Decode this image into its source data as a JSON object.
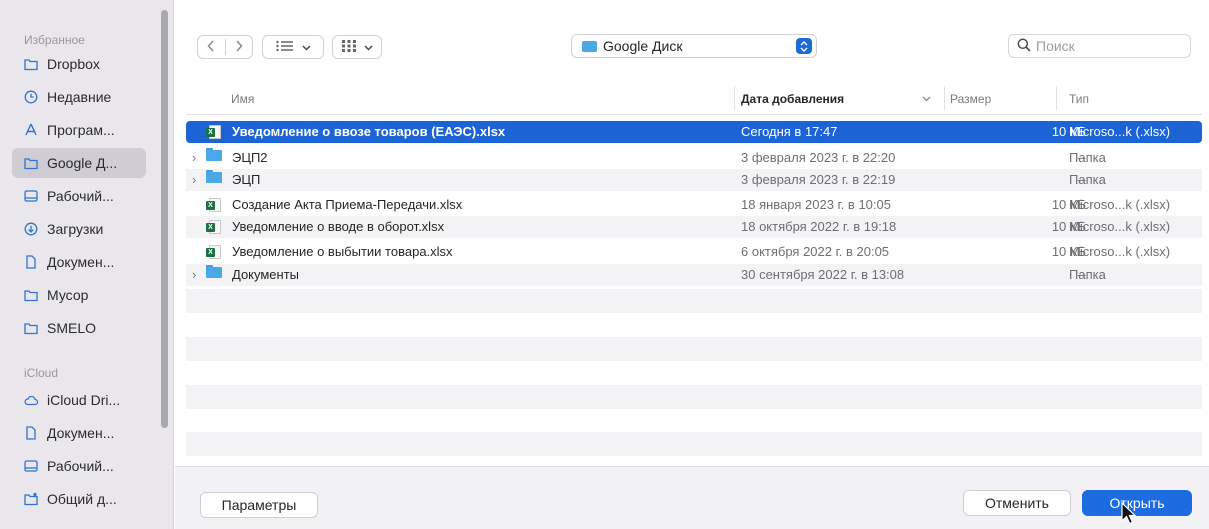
{
  "sidebar": {
    "favorites_header": "Избранное",
    "favorites": [
      {
        "label": "Dropbox",
        "icon": "folder-icon",
        "active": false
      },
      {
        "label": "Недавние",
        "icon": "clock-icon",
        "active": false
      },
      {
        "label": "Програм...",
        "icon": "apps-icon",
        "active": false
      },
      {
        "label": "Google Д...",
        "icon": "folder-icon",
        "active": true
      },
      {
        "label": "Рабочий...",
        "icon": "desktop-icon",
        "active": false
      },
      {
        "label": "Загрузки",
        "icon": "download-icon",
        "active": false
      },
      {
        "label": "Докумен...",
        "icon": "document-icon",
        "active": false
      },
      {
        "label": "Мусор",
        "icon": "folder-icon",
        "active": false
      },
      {
        "label": "SMELO",
        "icon": "folder-icon",
        "active": false
      }
    ],
    "icloud_header": "iCloud",
    "icloud": [
      {
        "label": "iCloud Dri...",
        "icon": "cloud-icon"
      },
      {
        "label": "Докумен...",
        "icon": "document-icon"
      },
      {
        "label": "Рабочий...",
        "icon": "desktop-icon"
      },
      {
        "label": "Общий д...",
        "icon": "shared-folder-icon"
      }
    ]
  },
  "toolbar": {
    "location": "Google Диск",
    "search_placeholder": "Поиск"
  },
  "table": {
    "headers": {
      "name": "Имя",
      "date": "Дата добавления",
      "size": "Размер",
      "type": "Тип"
    },
    "rows": [
      {
        "name": "Уведомление о ввозе товаров (ЕАЭС).xlsx",
        "date": "Сегодня в 17:47",
        "size": "10 КБ",
        "type": "Microso...k (.xlsx)",
        "kind": "xlsx",
        "expandable": false,
        "selected": true
      },
      {
        "name": "ЭЦП2",
        "date": "3 февраля 2023 г. в 22:20",
        "size": "--",
        "type": "Папка",
        "kind": "folder",
        "expandable": true,
        "selected": false
      },
      {
        "name": "ЭЦП",
        "date": "3 февраля 2023 г. в 22:19",
        "size": "--",
        "type": "Папка",
        "kind": "folder",
        "expandable": true,
        "selected": false
      },
      {
        "name": "Создание Акта Приема-Передачи.xlsx",
        "date": "18 января 2023 г. в 10:05",
        "size": "10 КБ",
        "type": "Microso...k (.xlsx)",
        "kind": "xlsx",
        "expandable": false,
        "selected": false
      },
      {
        "name": "Уведомление о вводе в оборот.xlsx",
        "date": "18 октября 2022 г. в 19:18",
        "size": "10 КБ",
        "type": "Microso...k (.xlsx)",
        "kind": "xlsx",
        "expandable": false,
        "selected": false
      },
      {
        "name": "Уведомление о выбытии товара.xlsx",
        "date": "6 октября 2022 г. в 20:05",
        "size": "10 КБ",
        "type": "Microso...k (.xlsx)",
        "kind": "xlsx",
        "expandable": false,
        "selected": false
      },
      {
        "name": "Документы",
        "date": "30 сентября 2022 г. в 13:08",
        "size": "--",
        "type": "Папка",
        "kind": "folder",
        "expandable": true,
        "selected": false
      }
    ]
  },
  "footer": {
    "options_label": "Параметры",
    "cancel_label": "Отменить",
    "open_label": "Открыть"
  },
  "colors": {
    "accent": "#1c64d6",
    "folder": "#4ba8e6",
    "excel": "#1d7044"
  }
}
